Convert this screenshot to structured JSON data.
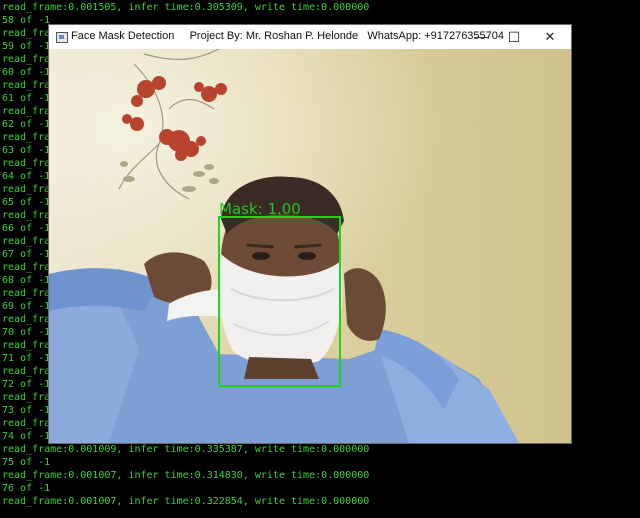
{
  "console": {
    "top_line": "read_frame:0.001505, infer time:0.305309, write time:0.000000",
    "left_lines": [
      "58 of -1",
      "read_fra",
      "59 of -1",
      "read_fra",
      "60 of -1",
      "read_fra",
      "61 of -1",
      "read_fra",
      "62 of -1",
      "read_fra",
      "63 of -1",
      "read_fra",
      "64 of -1",
      "read_fra",
      "65 of -1",
      "read_fra",
      "66 of -1",
      "read_fra",
      "67 of -1",
      "read_fra",
      "68 of -1",
      "read_fra",
      "69 of -1",
      "read_fra",
      "70 of -1",
      "read_fra",
      "71 of -1",
      "read_fra",
      "72 of -1",
      "read_fra",
      "73 of -1",
      "read_fra",
      "74 of -1"
    ],
    "bottom_lines": [
      "read_frame:0.001009, infer time:0.335387, write time:0.000000",
      "75 of -1",
      "read_frame:0.001007, infer time:0.314830, write time:0.000000",
      "76 of -1",
      "read_frame:0.001007, infer time:0.322854, write time:0.000000"
    ],
    "text_color": "#3fd13f"
  },
  "window": {
    "title": "Face Mask Detection     Project By: Mr. Roshan P. Helonde   WhatsApp: +917276355704",
    "minimize_glyph": "—",
    "maximize_glyph": "☐",
    "close_glyph": "✕"
  },
  "detection": {
    "label": "Mask: 1.00",
    "box_color": "#1bd61b"
  }
}
